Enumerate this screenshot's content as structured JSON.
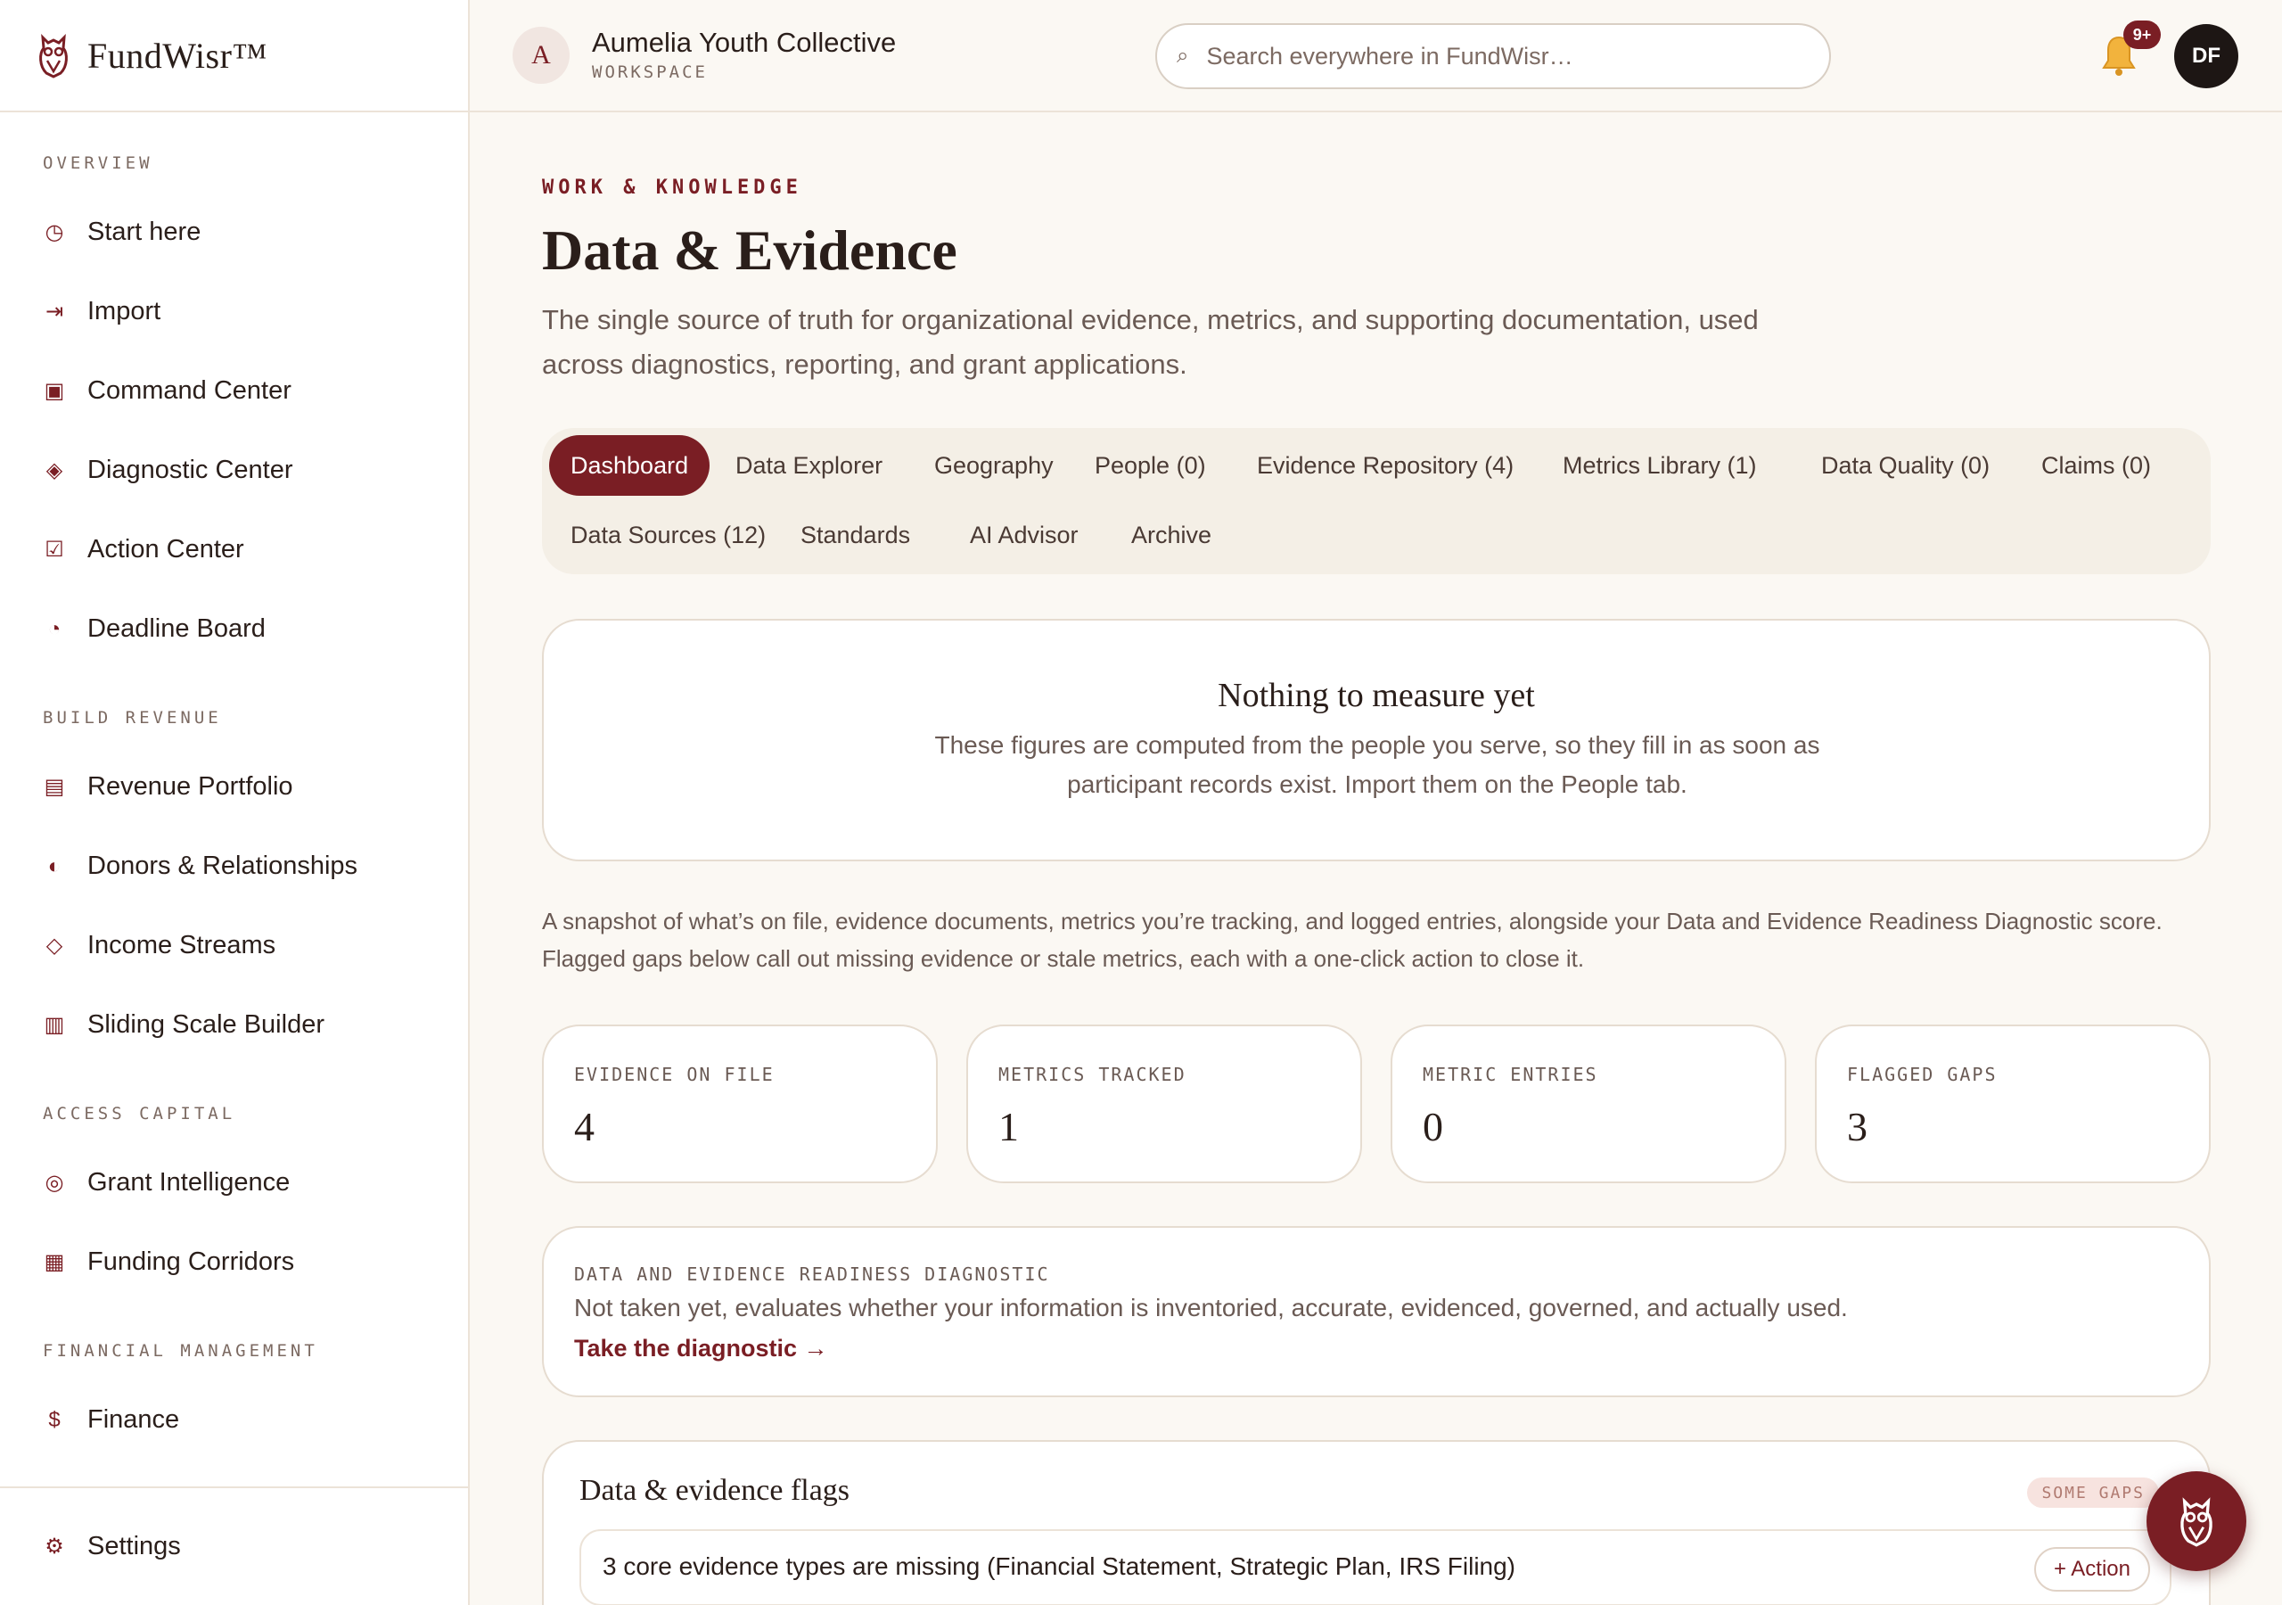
{
  "brand": {
    "name": "FundWisr™",
    "logo_icon": "owl-logo-icon"
  },
  "sidebar": {
    "sections": [
      {
        "title": "OVERVIEW",
        "items": [
          {
            "label": "Start here",
            "icon": "clock-icon"
          },
          {
            "label": "Import",
            "icon": "import-arrow-icon"
          },
          {
            "label": "Command Center",
            "icon": "square-target-icon"
          },
          {
            "label": "Diagnostic Center",
            "icon": "diamond-icon"
          },
          {
            "label": "Action Center",
            "icon": "checkbox-icon"
          },
          {
            "label": "Deadline Board",
            "icon": "pie-clock-icon"
          }
        ]
      },
      {
        "title": "BUILD REVENUE",
        "items": [
          {
            "label": "Revenue Portfolio",
            "icon": "list-icon"
          },
          {
            "label": "Donors & Relationships",
            "icon": "half-circle-icon"
          },
          {
            "label": "Income Streams",
            "icon": "diamond-outline-icon"
          },
          {
            "label": "Sliding Scale Builder",
            "icon": "columns-icon"
          }
        ]
      },
      {
        "title": "ACCESS CAPITAL",
        "items": [
          {
            "label": "Grant Intelligence",
            "icon": "target-icon"
          },
          {
            "label": "Funding Corridors",
            "icon": "grid-icon"
          }
        ]
      },
      {
        "title": "FINANCIAL MANAGEMENT",
        "items": [
          {
            "label": "Finance",
            "icon": "dollar-icon"
          }
        ]
      }
    ],
    "settings": {
      "label": "Settings",
      "icon": "gear-icon"
    }
  },
  "topbar": {
    "workspace_initial": "A",
    "workspace_name": "Aumelia Youth Collective",
    "workspace_sub": "WORKSPACE",
    "search_placeholder": "Search everywhere in FundWisr…",
    "notification_count": "9+",
    "user_initials": "DF"
  },
  "page": {
    "eyebrow": "WORK & KNOWLEDGE",
    "title": "Data & Evidence",
    "description": "The single source of truth for organizational evidence, metrics, and supporting documentation, used across diagnostics, reporting, and grant applications."
  },
  "tabs": [
    {
      "label": "Dashboard",
      "active": true
    },
    {
      "label": "Data Explorer"
    },
    {
      "label": "Geography"
    },
    {
      "label": "People (0)"
    },
    {
      "label": "Evidence Repository (4)"
    },
    {
      "label": "Metrics Library (1)"
    },
    {
      "label": "Data Quality (0)"
    },
    {
      "label": "Claims (0)"
    },
    {
      "label": "Data Sources (12)"
    },
    {
      "label": "Standards"
    },
    {
      "label": "AI Advisor"
    },
    {
      "label": "Archive"
    }
  ],
  "empty_state": {
    "title": "Nothing to measure yet",
    "text": "These figures are computed from the people you serve, so they fill in as soon as participant records exist. Import them on the People tab."
  },
  "snapshot_text": "A snapshot of what’s on file, evidence documents, metrics you’re tracking, and logged entries, alongside your Data and Evidence Readiness Diagnostic score. Flagged gaps below call out missing evidence or stale metrics, each with a one-click action to close it.",
  "stats": [
    {
      "label": "EVIDENCE ON FILE",
      "value": "4"
    },
    {
      "label": "METRICS TRACKED",
      "value": "1"
    },
    {
      "label": "METRIC ENTRIES",
      "value": "0"
    },
    {
      "label": "FLAGGED GAPS",
      "value": "3"
    }
  ],
  "diagnostic": {
    "label": "DATA AND EVIDENCE READINESS DIAGNOSTIC",
    "text": "Not taken yet, evaluates whether your information is inventoried, accurate, evidenced, governed, and actually used.",
    "link": "Take the diagnostic →"
  },
  "flags": {
    "title": "Data & evidence flags",
    "badge": "SOME GAPS",
    "items": [
      {
        "text": "3 core evidence types are missing (Financial Statement, Strategic Plan, IRS Filing)",
        "action": "+ Action"
      }
    ]
  },
  "colors": {
    "accent": "#7a1e24",
    "background": "#fbf8f3",
    "card": "#ffffff",
    "text": "#2a1e1a",
    "muted": "#6a5a54"
  }
}
